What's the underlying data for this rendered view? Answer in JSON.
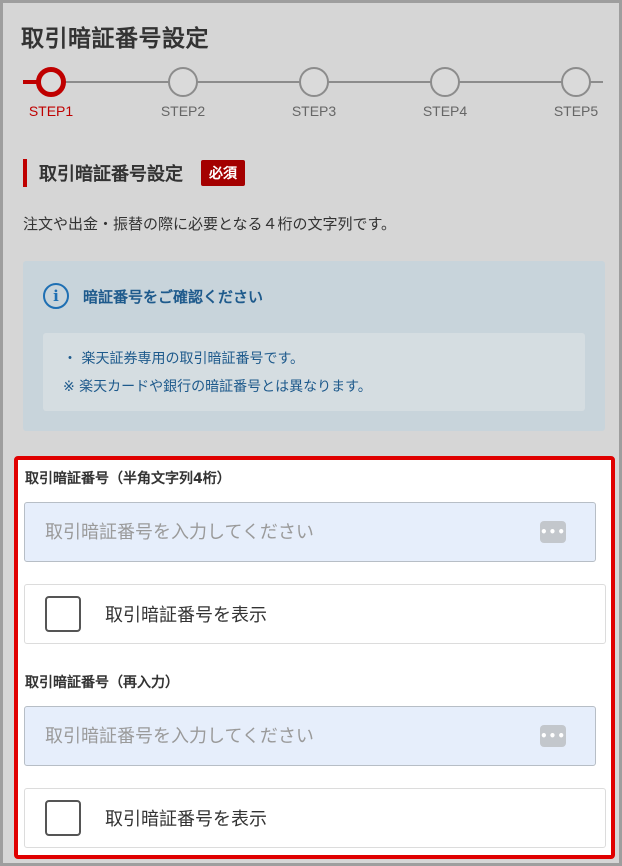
{
  "page": {
    "title": "取引暗証番号設定"
  },
  "stepper": {
    "steps": [
      {
        "label": "STEP1",
        "active": true
      },
      {
        "label": "STEP2",
        "active": false
      },
      {
        "label": "STEP3",
        "active": false
      },
      {
        "label": "STEP4",
        "active": false
      },
      {
        "label": "STEP5",
        "active": false
      }
    ]
  },
  "section": {
    "heading": "取引暗証番号設定",
    "required_badge": "必須",
    "description": "注文や出金・振替の際に必要となる４桁の文字列です。"
  },
  "info": {
    "icon_char": "i",
    "title": "暗証番号をご確認ください",
    "lines": [
      "・ 楽天証券専用の取引暗証番号です。",
      "※ 楽天カードや銀行の暗証番号とは異なります。"
    ]
  },
  "form": {
    "field1": {
      "label": "取引暗証番号（半角文字列4桁）",
      "value": "",
      "placeholder": "取引暗証番号を入力してください",
      "icon": "dots-icon",
      "icon_text": "•••"
    },
    "show1": {
      "label": "取引暗証番号を表示",
      "checked": false
    },
    "field2": {
      "label": "取引暗証番号（再入力）",
      "value": "",
      "placeholder": "取引暗証番号を入力してください",
      "icon": "dots-icon",
      "icon_text": "•••"
    },
    "show2": {
      "label": "取引暗証番号を表示",
      "checked": false
    }
  },
  "colors": {
    "accent": "#bf0000",
    "highlight_border": "#e00000",
    "info_text": "#1e5a8c"
  }
}
